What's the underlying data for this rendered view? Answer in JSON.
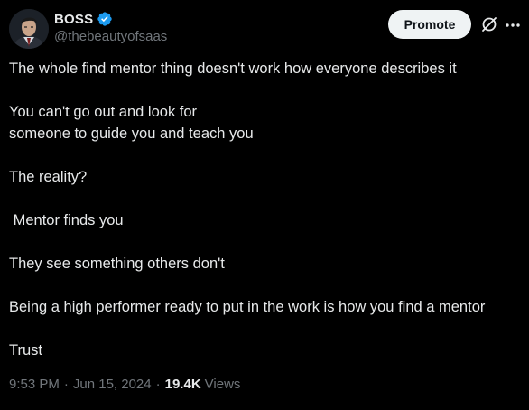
{
  "author": {
    "display_name": "BOSS",
    "handle": "@thebeautyofsaas",
    "verified": true,
    "verified_color": "#1d9bf0",
    "avatar_icon": "avatar-icon"
  },
  "actions": {
    "promote_label": "Promote",
    "grok_icon": "grok-icon",
    "more_icon": "more-icon"
  },
  "tweet": {
    "paragraphs": [
      "The whole find mentor thing doesn't work how everyone describes it",
      "You can't go out and look for\nsomeone to guide you and teach you",
      "The reality?",
      " Mentor finds you",
      "They see something others don't",
      "Being a high performer ready to put in the work is how you find a mentor",
      "Trust"
    ]
  },
  "meta": {
    "time": "9:53 PM",
    "separator": "·",
    "date": "Jun 15, 2024",
    "views_count": "19.4K",
    "views_label": "Views"
  },
  "colors": {
    "background": "#000000",
    "text": "#e7e9ea",
    "secondary_text": "#71767b",
    "button_bg": "#eff3f4",
    "button_text": "#0f1419"
  }
}
